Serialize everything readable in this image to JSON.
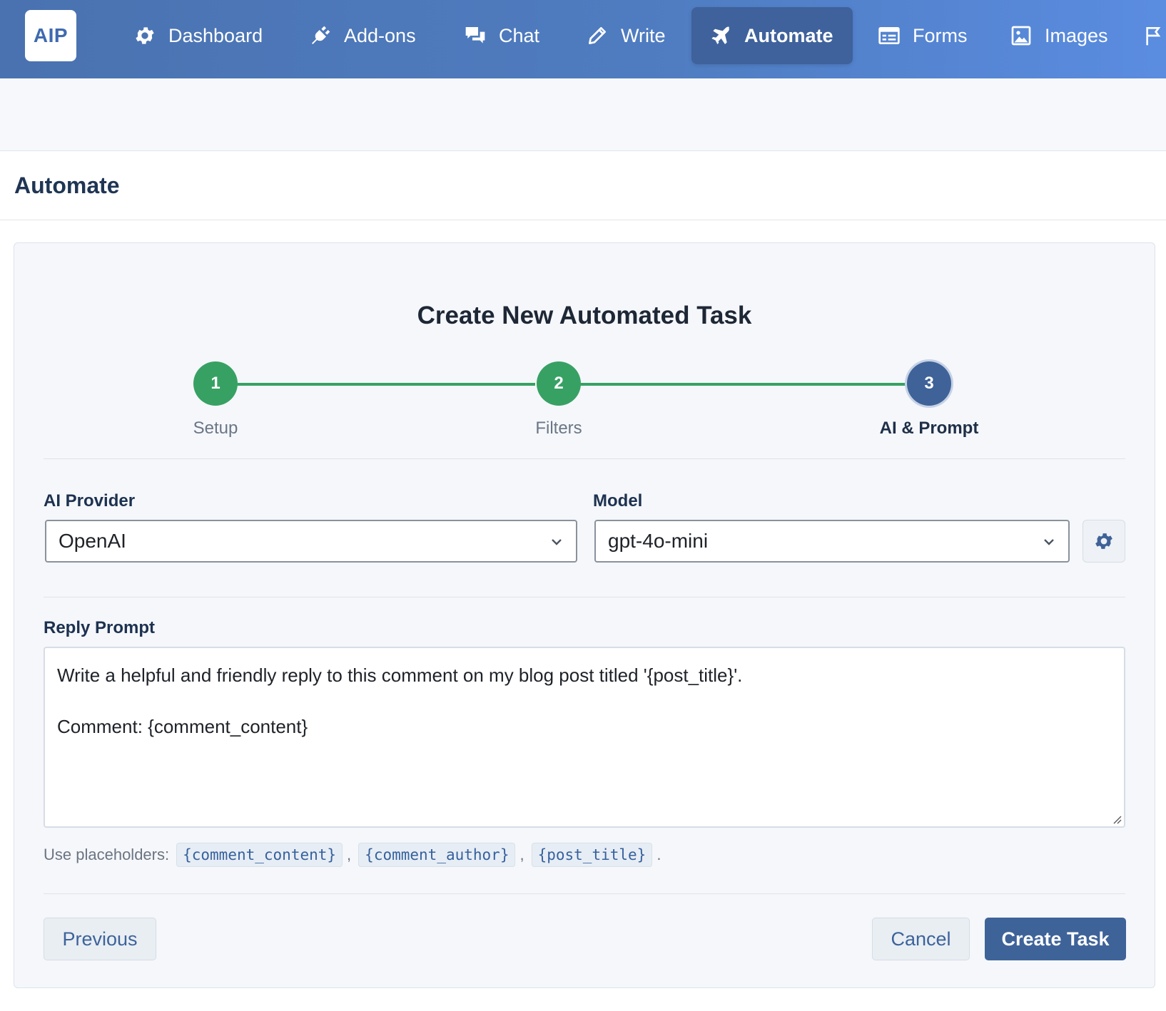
{
  "app": {
    "logo_text": "AIP"
  },
  "nav": {
    "items": [
      {
        "label": "Dashboard",
        "icon": "gear-icon",
        "active": false
      },
      {
        "label": "Add-ons",
        "icon": "plug-icon",
        "active": false
      },
      {
        "label": "Chat",
        "icon": "chat-bubbles-icon",
        "active": false
      },
      {
        "label": "Write",
        "icon": "pencil-icon",
        "active": false
      },
      {
        "label": "Automate",
        "icon": "plane-icon",
        "active": true
      },
      {
        "label": "Forms",
        "icon": "form-icon",
        "active": false
      },
      {
        "label": "Images",
        "icon": "image-icon",
        "active": false
      }
    ],
    "overflow_icon": "flag-icon"
  },
  "page": {
    "title": "Automate"
  },
  "wizard": {
    "title": "Create New Automated Task",
    "steps": [
      {
        "number": "1",
        "label": "Setup",
        "state": "done"
      },
      {
        "number": "2",
        "label": "Filters",
        "state": "done"
      },
      {
        "number": "3",
        "label": "AI & Prompt",
        "state": "current"
      }
    ],
    "provider": {
      "label": "AI Provider",
      "value": "OpenAI"
    },
    "model": {
      "label": "Model",
      "value": "gpt-4o-mini",
      "settings_icon": "gear-icon"
    },
    "prompt": {
      "label": "Reply Prompt",
      "lines": [
        "Write a helpful and friendly reply to this comment on my blog post titled '{post_title}'.",
        "",
        "Comment: {comment_content}"
      ]
    },
    "placeholders": {
      "prefix": "Use placeholders:",
      "items": [
        "{comment_content}",
        "{comment_author}",
        "{post_title}"
      ],
      "separator": ",",
      "suffix": "."
    },
    "buttons": {
      "previous": "Previous",
      "cancel": "Cancel",
      "create": "Create Task"
    }
  },
  "colors": {
    "nav_gradient_start": "#4a72b0",
    "nav_gradient_end": "#5a8ce0",
    "active_nav": "#3f629c",
    "step_done": "#37a163",
    "step_current": "#3f6298",
    "primary_button": "#3e6399"
  }
}
